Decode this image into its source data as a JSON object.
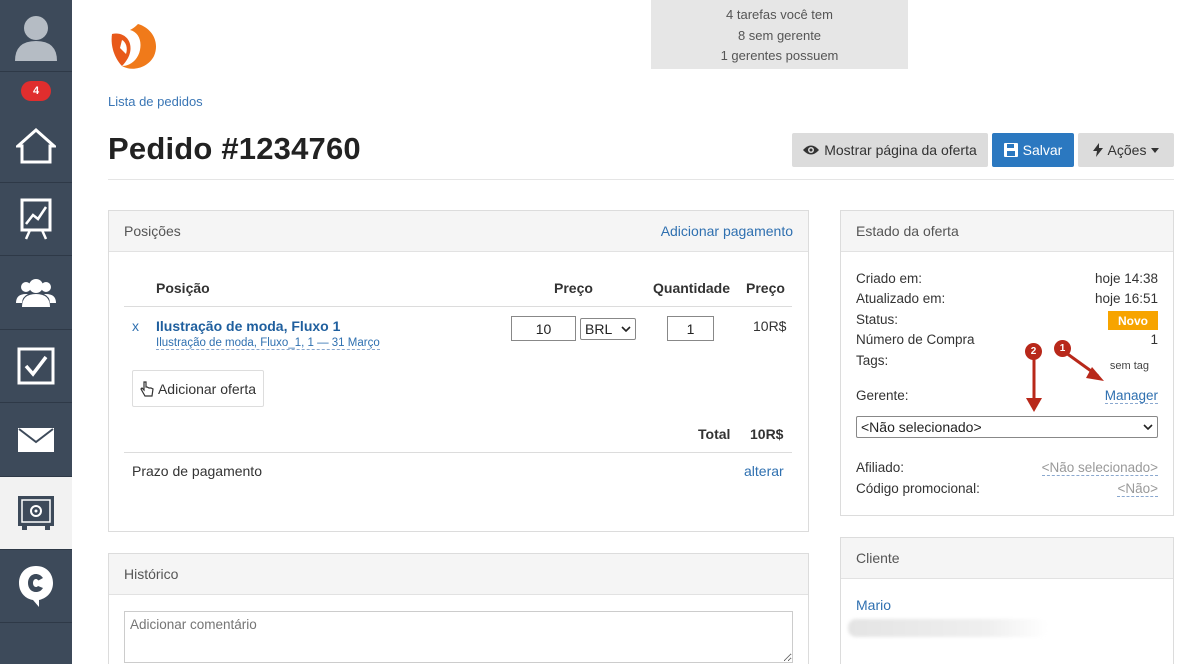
{
  "sidebar": {
    "notifications_count": "4",
    "items": [
      {
        "icon": "user-avatar-icon"
      },
      {
        "icon": "home-icon"
      },
      {
        "icon": "chart-board-icon"
      },
      {
        "icon": "users-icon"
      },
      {
        "icon": "checkbox-icon"
      },
      {
        "icon": "mail-icon"
      },
      {
        "icon": "safe-icon"
      },
      {
        "icon": "brand-c-icon"
      }
    ]
  },
  "top_info": {
    "line1": "4 tarefas você tem",
    "line2": "8 sem gerente",
    "line3": "1 gerentes possuem"
  },
  "breadcrumb": "Lista de pedidos",
  "page_title": "Pedido #1234760",
  "toolbar": {
    "show_offer_label": "Mostrar página da oferta",
    "save_label": "Salvar",
    "actions_label": "Ações"
  },
  "positions": {
    "title": "Posições",
    "add_payment": "Adicionar pagamento",
    "headers": {
      "position": "Posição",
      "price": "Preço",
      "quantity": "Quantidade",
      "total_price": "Preço"
    },
    "item": {
      "remove": "x",
      "name": "Ilustração de moda, Fluxo 1",
      "subtitle": "Ilustração de moda, Fluxo_1, 1 — 31 Março",
      "price": "10",
      "currency": "BRL",
      "quantity": "1",
      "line_total": "10R$"
    },
    "add_offer": "Adicionar oferta",
    "total_label": "Total",
    "total_value": "10R$",
    "payment_term_label": "Prazo de pagamento",
    "change_label": "alterar"
  },
  "history": {
    "title": "Histórico",
    "comment_placeholder": "Adicionar comentário"
  },
  "offer_state": {
    "title": "Estado da oferta",
    "created_label": "Criado em:",
    "created_value": "hoje 14:38",
    "updated_label": "Atualizado em:",
    "updated_value": "hoje 16:51",
    "status_label": "Status:",
    "status_value": "Novo",
    "purchase_number_label": "Número de Compra",
    "purchase_number_value": "1",
    "tags_label": "Tags:",
    "tags_value": "sem tag",
    "manager_label": "Gerente:",
    "manager_link": "Manager",
    "manager_select": "<Não selecionado>",
    "affiliate_label": "Afiliado:",
    "affiliate_value": "<Não selecionado>",
    "promo_label": "Código promocional:",
    "promo_value": "<Não>",
    "annotation_1": "1",
    "annotation_2": "2"
  },
  "client": {
    "title": "Cliente",
    "name": "Mario"
  },
  "colors": {
    "sidebar": "#3d4a5a",
    "accent_blue": "#2b78c0",
    "status_orange": "#f7a400",
    "annotation_red": "#b8281a",
    "badge_red": "#e02e2e"
  }
}
